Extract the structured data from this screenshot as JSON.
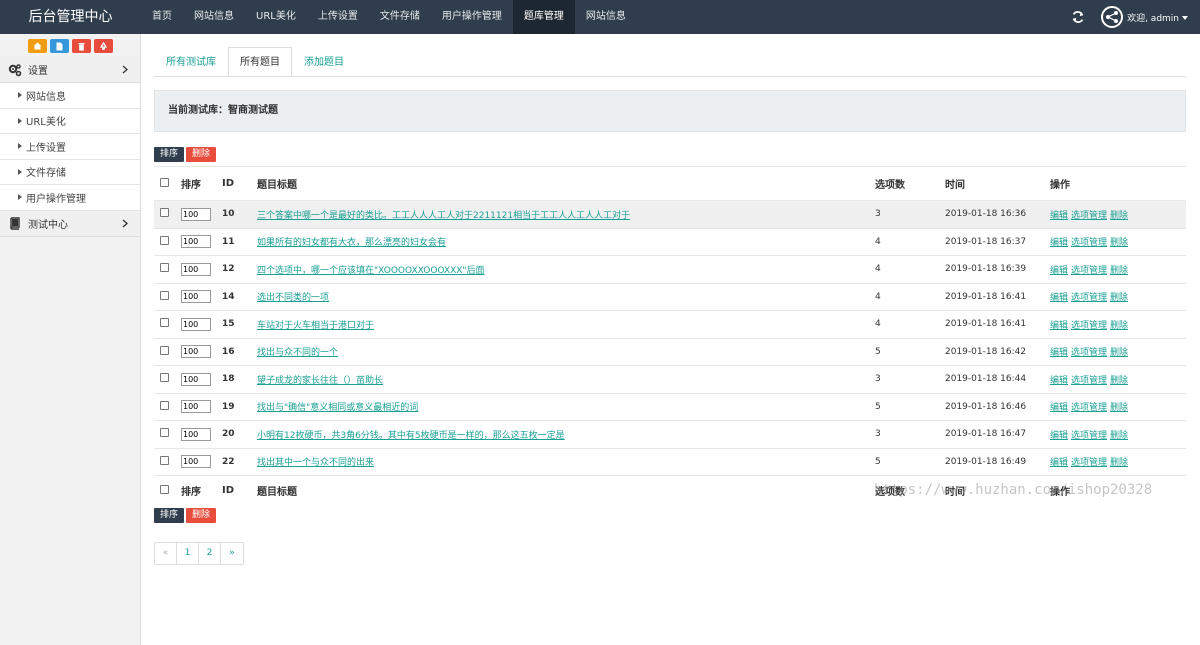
{
  "header": {
    "brand": "后台管理中心",
    "nav": [
      "首页",
      "网站信息",
      "URL美化",
      "上传设置",
      "文件存储",
      "用户操作管理",
      "题库管理",
      "网站信息"
    ],
    "active_index": 6,
    "welcome": "欢迎, admin"
  },
  "sidebar": {
    "quick_buttons": [
      {
        "name": "home-icon",
        "color": "#f39c12"
      },
      {
        "name": "file-icon",
        "color": "#3498db"
      },
      {
        "name": "trash-icon",
        "color": "#e74c3c"
      },
      {
        "name": "recycle-icon",
        "color": "#e74c3c"
      }
    ],
    "group_settings": "设置",
    "items": [
      "网站信息",
      "URL美化",
      "上传设置",
      "文件存储",
      "用户操作管理"
    ],
    "group_test": "测试中心"
  },
  "tabs": [
    "所有测试库",
    "所有题目",
    "添加题目"
  ],
  "current_library": "当前测试库：智商测试题",
  "buttons": {
    "sort": "排序",
    "delete": "删除"
  },
  "table": {
    "headers": {
      "sort": "排序",
      "id": "ID",
      "title": "题目标题",
      "count": "选项数",
      "time": "时间",
      "actions": "操作"
    },
    "rows": [
      {
        "sort": "100",
        "id": "10",
        "title": "三个答案中哪一个是最好的类比。工工人人人工人对于2211121相当于工工人人工人人工对于",
        "count": "3",
        "time": "2019-01-18 16:36"
      },
      {
        "sort": "100",
        "id": "11",
        "title": "如果所有的妇女都有大衣，那么漂亮的妇女会有",
        "count": "4",
        "time": "2019-01-18 16:37"
      },
      {
        "sort": "100",
        "id": "12",
        "title": "四个选项中，哪一个应该填在\"XOOOOXXOOOXXX\"后面",
        "count": "4",
        "time": "2019-01-18 16:39"
      },
      {
        "sort": "100",
        "id": "14",
        "title": "选出不同类的一项",
        "count": "4",
        "time": "2019-01-18 16:41"
      },
      {
        "sort": "100",
        "id": "15",
        "title": "车站对于火车相当于港口对于",
        "count": "4",
        "time": "2019-01-18 16:41"
      },
      {
        "sort": "100",
        "id": "16",
        "title": "找出与众不同的一个",
        "count": "5",
        "time": "2019-01-18 16:42"
      },
      {
        "sort": "100",
        "id": "18",
        "title": "望子成龙的家长往往（）苗助长",
        "count": "3",
        "time": "2019-01-18 16:44"
      },
      {
        "sort": "100",
        "id": "19",
        "title": "找出与\"确信\"意义相同或意义最相近的词",
        "count": "5",
        "time": "2019-01-18 16:46"
      },
      {
        "sort": "100",
        "id": "20",
        "title": "小明有12枚硬币，共3角6分钱。其中有5枚硬币是一样的，那么这五枚一定是",
        "count": "3",
        "time": "2019-01-18 16:47"
      },
      {
        "sort": "100",
        "id": "22",
        "title": "找出其中一个与众不同的出来",
        "count": "5",
        "time": "2019-01-18 16:49"
      }
    ],
    "actions": [
      "编辑",
      "选项管理",
      "删除"
    ]
  },
  "pagination": [
    "«",
    "1",
    "2",
    "»"
  ],
  "watermark": "https://www.huzhan.com/ishop20328"
}
